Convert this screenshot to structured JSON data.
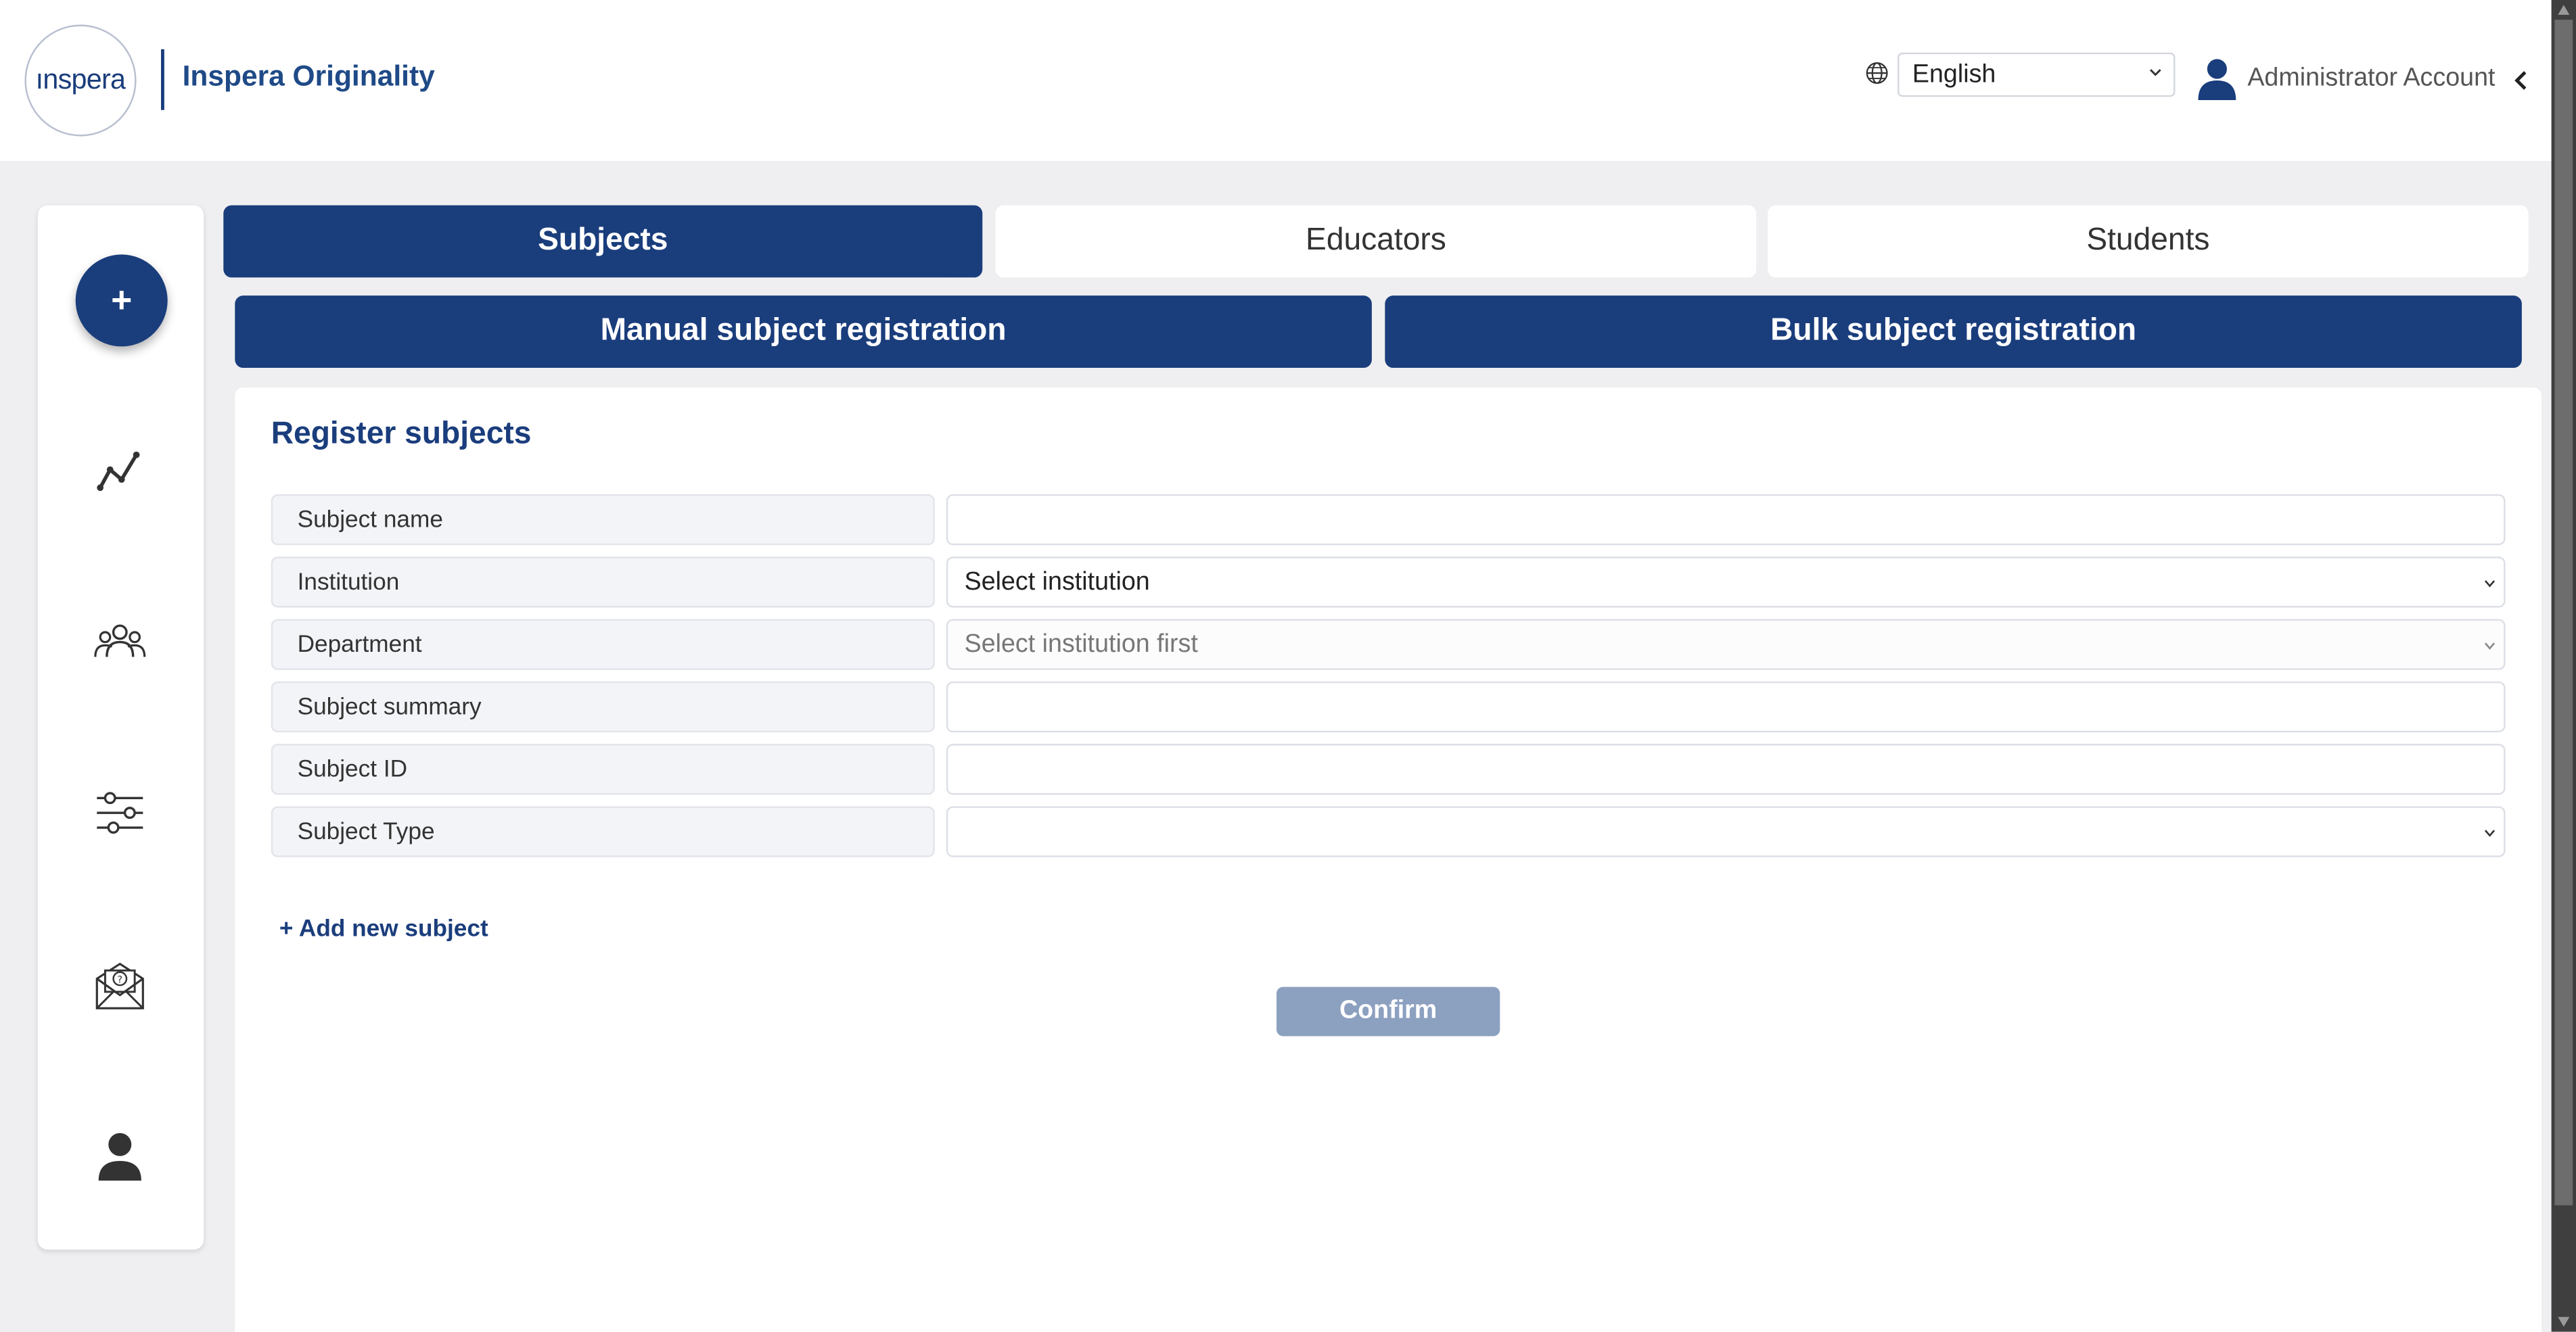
{
  "header": {
    "logo_text": "ınspera",
    "brand": "Inspera Originality",
    "language": "English",
    "user": "Administrator Account"
  },
  "sidenav": {
    "plus_label": "+",
    "icons": [
      "analytics-icon",
      "users-group-icon",
      "settings-sliders-icon",
      "help-mail-icon",
      "profile-icon"
    ]
  },
  "tabs": [
    {
      "label": "Subjects",
      "active": true
    },
    {
      "label": "Educators",
      "active": false
    },
    {
      "label": "Students",
      "active": false
    }
  ],
  "subtabs": [
    {
      "label": "Manual subject registration"
    },
    {
      "label": "Bulk subject registration"
    }
  ],
  "form": {
    "title": "Register subjects",
    "fields": [
      {
        "label": "Subject name",
        "value": "",
        "type": "text"
      },
      {
        "label": "Institution",
        "value": "Select institution",
        "type": "select"
      },
      {
        "label": "Department",
        "value": "Select institution first",
        "type": "select-disabled"
      },
      {
        "label": "Subject summary",
        "value": "",
        "type": "text"
      },
      {
        "label": "Subject ID",
        "value": "",
        "type": "text"
      },
      {
        "label": "Subject Type",
        "value": "",
        "type": "select"
      }
    ],
    "add_link": "+ Add new subject",
    "confirm": "Confirm"
  },
  "colors": {
    "primary": "#1a3d7c",
    "confirm_disabled": "#8ca0c0",
    "background": "#efeff1"
  }
}
